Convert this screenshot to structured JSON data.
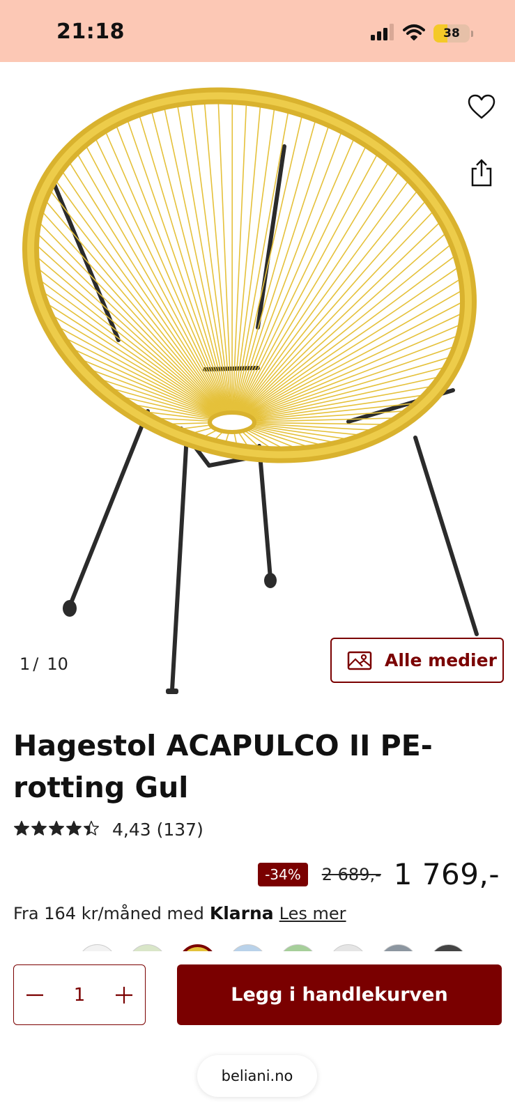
{
  "status_bar": {
    "time": "21:18",
    "battery": "38",
    "battery_level": 0.38,
    "bg_color": "#fcc8b5"
  },
  "media": {
    "counter_current": "1",
    "counter_separator": "/",
    "counter_total": "10",
    "all_media_label": "Alle medier",
    "image_alt": "Hagestol ACAPULCO II PE-rotting Gul"
  },
  "product": {
    "title": "Hagestol ACAPULCO II PE-rotting Gul",
    "rating_value": 4.43,
    "rating_text": "4,43 (137)"
  },
  "pricing": {
    "discount": "-34%",
    "old_price": "2 689,-",
    "price": "1 769,-",
    "financing_text": "Fra 164 kr/måned med",
    "financing_brand": "Klarna",
    "read_more": "Les mer"
  },
  "swatches": [
    {
      "color": "#f2f2f2",
      "selected": false
    },
    {
      "color": "#d9e6c8",
      "selected": false
    },
    {
      "color": "#e3c23a",
      "selected": true
    },
    {
      "color": "#b9d2ea",
      "selected": false
    },
    {
      "color": "#a6cf9a",
      "selected": false
    },
    {
      "color": "#e5e5e5",
      "selected": false
    },
    {
      "color": "#8c96a0",
      "selected": false
    },
    {
      "color": "#444444",
      "selected": false
    }
  ],
  "cart": {
    "quantity": "1",
    "add_to_cart_label": "Legg i handlekurven"
  },
  "browser": {
    "url": "beliani.no"
  },
  "colors": {
    "brand": "#7a0000",
    "chair_yellow": "#e8c43a"
  }
}
